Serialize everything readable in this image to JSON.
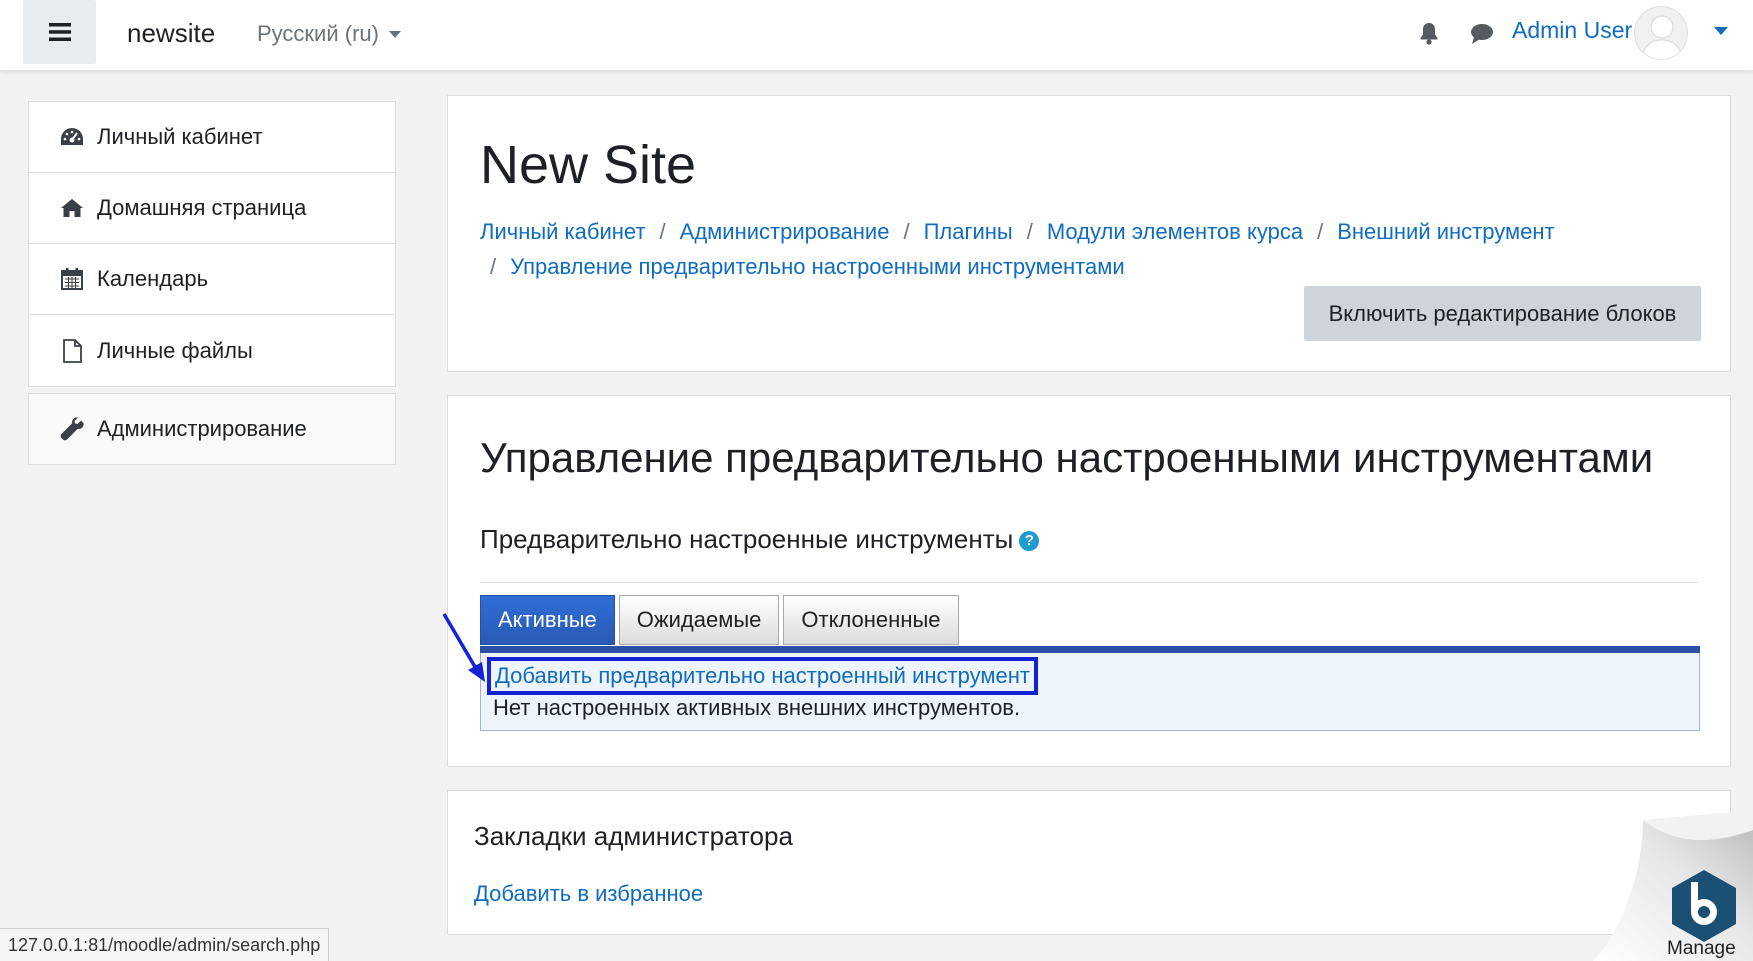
{
  "navbar": {
    "brand": "newsite",
    "language": "Русский (ru)",
    "username": "Admin User"
  },
  "sidebar": {
    "items": [
      {
        "label": "Личный кабинет",
        "icon": "dashboard-icon"
      },
      {
        "label": "Домашняя страница",
        "icon": "home-icon"
      },
      {
        "label": "Календарь",
        "icon": "calendar-icon"
      },
      {
        "label": "Личные файлы",
        "icon": "file-icon"
      }
    ],
    "admin": {
      "label": "Администрирование",
      "icon": "wrench-icon"
    }
  },
  "header": {
    "site_title": "New Site",
    "breadcrumb": [
      "Личный кабинет",
      "Администрирование",
      "Плагины",
      "Модули элементов курса",
      "Внешний инструмент",
      "Управление предварительно настроенными инструментами"
    ],
    "edit_button": "Включить редактирование блоков"
  },
  "main": {
    "heading": "Управление предварительно настроенными инструментами",
    "subheading": "Предварительно настроенные инструменты",
    "tabs": [
      "Активные",
      "Ожидаемые",
      "Отклоненные"
    ],
    "active_tab": "Активные",
    "add_link": "Добавить предварительно настроенный инструмент",
    "empty_message": "Нет настроенных активных внешних инструментов."
  },
  "bookmarks": {
    "title": "Закладки администратора",
    "add_link": "Добавить в избранное"
  },
  "status_url": "127.0.0.1:81/moodle/admin/search.php",
  "manage_label": "Manage",
  "colors": {
    "link": "#0f6cbf",
    "tab_active": "#2c4fa7",
    "highlight_box": "#1421d6"
  }
}
